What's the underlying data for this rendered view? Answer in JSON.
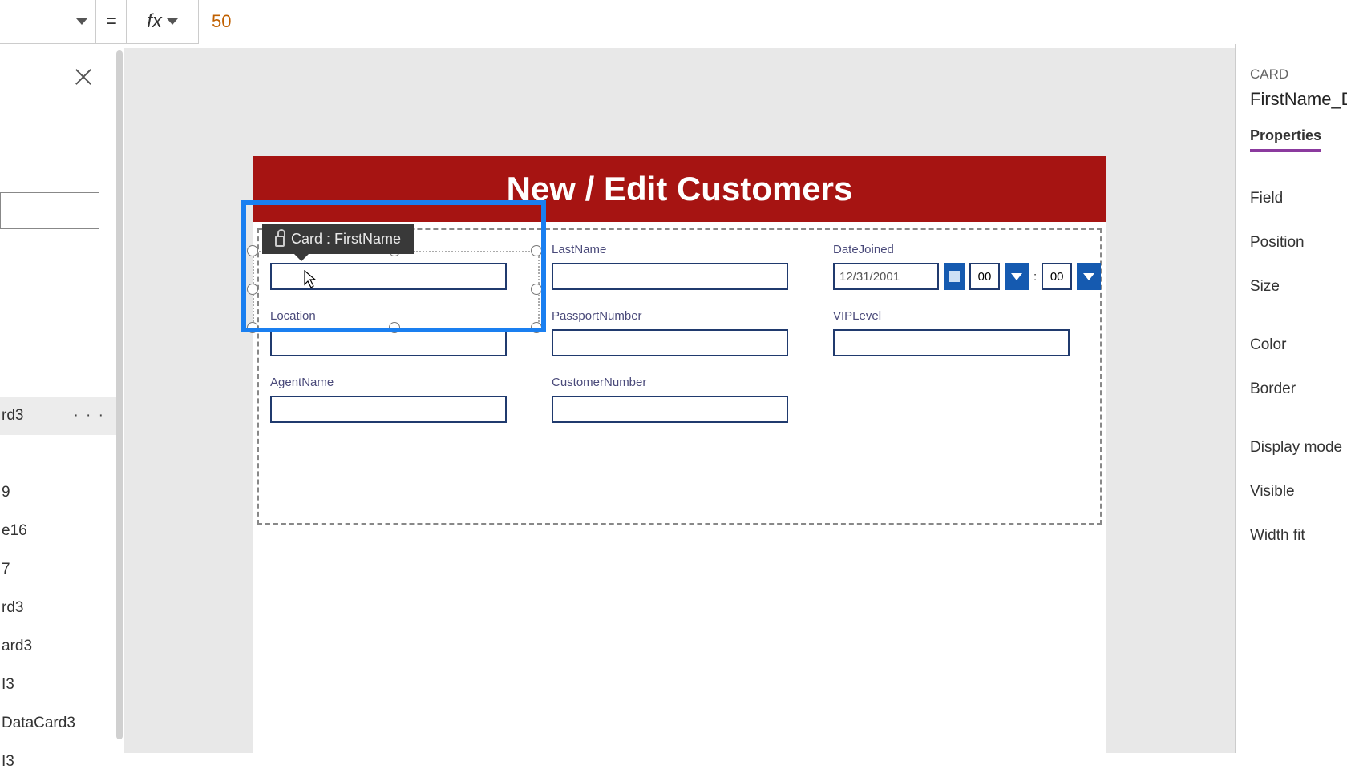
{
  "formula_bar": {
    "equals": "=",
    "fx": "fx",
    "value": "50"
  },
  "tree": {
    "items": [
      {
        "label": "rd3",
        "selected": true
      },
      {
        "label": "",
        "selected": false
      },
      {
        "label": "9",
        "selected": false
      },
      {
        "label": "e16",
        "selected": false
      },
      {
        "label": "7",
        "selected": false
      },
      {
        "label": "rd3",
        "selected": false
      },
      {
        "label": "ard3",
        "selected": false
      },
      {
        "label": "I3",
        "selected": false
      },
      {
        "label": "DataCard3",
        "selected": false
      },
      {
        "label": "I3",
        "selected": false
      }
    ]
  },
  "app": {
    "title": "New / Edit Customers",
    "cards": {
      "firstname": {
        "label": "FirstName",
        "value": ""
      },
      "lastname": {
        "label": "LastName",
        "value": ""
      },
      "datejoined": {
        "label": "DateJoined",
        "date": "12/31/2001",
        "hour": "00",
        "colon": ":",
        "minute": "00"
      },
      "location": {
        "label": "Location",
        "value": ""
      },
      "passportnumber": {
        "label": "PassportNumber",
        "value": ""
      },
      "viplevel": {
        "label": "VIPLevel",
        "value": ""
      },
      "agentname": {
        "label": "AgentName",
        "value": ""
      },
      "customernumber": {
        "label": "CustomerNumber",
        "value": ""
      }
    }
  },
  "tooltip": {
    "text": "Card : FirstName"
  },
  "props": {
    "type": "CARD",
    "name": "FirstName_D",
    "tab": "Properties",
    "rows": [
      "Field",
      "Position",
      "Size",
      "Color",
      "Border",
      "Display mode",
      "Visible",
      "Width fit"
    ]
  },
  "icons": {
    "dots": "· · ·"
  }
}
